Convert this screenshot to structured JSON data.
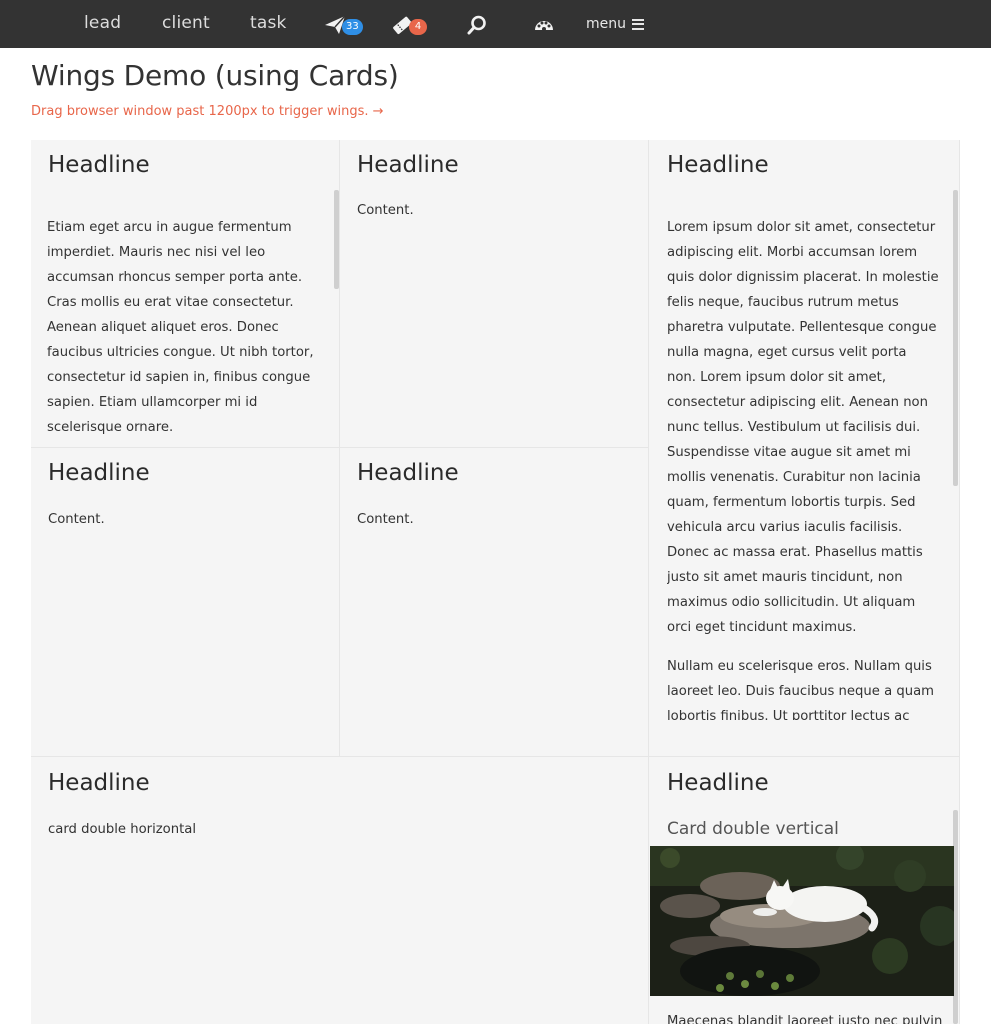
{
  "nav": {
    "links": [
      "lead",
      "client",
      "task"
    ],
    "send_badge": "33",
    "ticket_badge": "4",
    "menu_label": "menu",
    "colors": {
      "bar": "#333333",
      "badge_blue": "#2f8fe6",
      "badge_red": "#e8664a"
    },
    "icons": [
      "paper-plane-icon",
      "ticket-icon",
      "search-icon",
      "palette-icon",
      "hamburger-icon"
    ]
  },
  "page": {
    "title": "Wings Demo (using Cards)",
    "hint": "Drag browser window past 1200px to trigger wings. →"
  },
  "cards": [
    {
      "title": "Headline",
      "body": "Etiam eget arcu in augue fermentum imperdiet. Mauris nec nisi vel leo accumsan rhoncus semper porta ante. Cras mollis eu erat vitae consectetur. Aenean aliquet aliquet eros. Donec faucibus ultricies congue. Ut nibh tortor, consectetur id sapien in, finibus congue sapien. Etiam ullamcorper mi id scelerisque ornare."
    },
    {
      "title": "Headline",
      "body": "Content."
    },
    {
      "title": "Headline",
      "body": "Lorem ipsum dolor sit amet, consectetur adipiscing elit. Morbi accumsan lorem quis dolor dignissim placerat. In molestie felis neque, faucibus rutrum metus pharetra vulputate. Pellentesque congue nulla magna, eget cursus velit porta non. Lorem ipsum dolor sit amet, consectetur adipiscing elit. Aenean non nunc tellus. Vestibulum ut facilisis dui. Suspendisse vitae augue sit amet mi mollis venenatis. Curabitur non lacinia quam, fermentum lobortis turpis. Sed vehicula arcu varius iaculis facilisis. Donec ac massa erat. Phasellus mattis justo sit amet mauris tincidunt, non maximus odio sollicitudin. Ut aliquam orci eget tincidunt maximus.",
      "body2": "Nullam eu scelerisque eros. Nullam quis laoreet leo. Duis faucibus neque a quam lobortis finibus. Ut porttitor lectus ac tellus porttitor vulputate. Mauris eget leo vitae"
    },
    {
      "title": "Headline",
      "body": "Content."
    },
    {
      "title": "Headline",
      "body": "Content."
    },
    {
      "title": "Headline",
      "body": "card double horizontal"
    },
    {
      "title": "Headline",
      "subtitle": "Card double vertical",
      "body": "Maecenas blandit laoreet justo nec pulvinar"
    }
  ]
}
